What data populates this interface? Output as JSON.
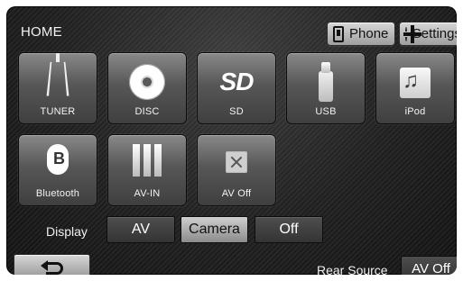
{
  "header": {
    "title": "HOME",
    "phone_label": "Phone",
    "settings_label": "Settings"
  },
  "sources": [
    {
      "label": "TUNER",
      "icon": "tower-icon"
    },
    {
      "label": "DISC",
      "icon": "disc-icon"
    },
    {
      "label": "SD",
      "icon": "sd-icon"
    },
    {
      "label": "USB",
      "icon": "usb-icon"
    },
    {
      "label": "iPod",
      "icon": "ipod-icon"
    },
    {
      "label": "Bluetooth",
      "icon": "bluetooth-icon"
    },
    {
      "label": "AV-IN",
      "icon": "av-in-icon"
    },
    {
      "label": "AV Off",
      "icon": "close-icon"
    }
  ],
  "sd_logo_text": "SD",
  "display": {
    "label": "Display",
    "options": [
      "AV",
      "Camera",
      "Off"
    ]
  },
  "rear_source": {
    "label": "Rear Source",
    "value": "AV Off"
  }
}
